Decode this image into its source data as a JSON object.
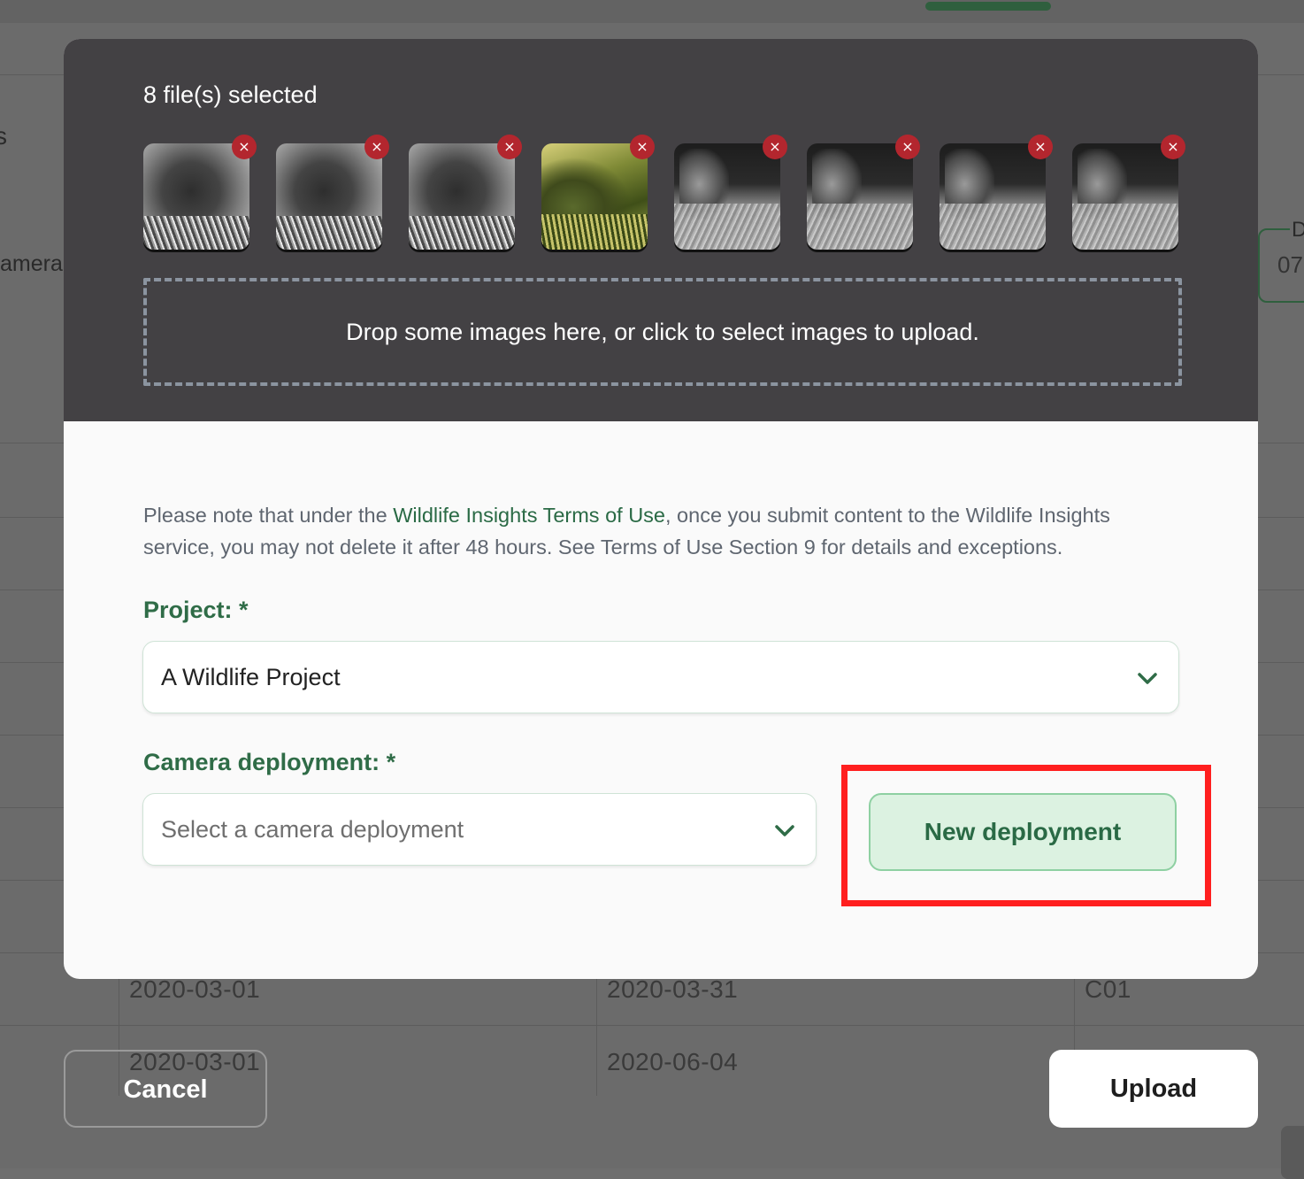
{
  "background": {
    "partial_heading": "s",
    "partial_column": "amera",
    "date_field_label": "D",
    "date_field_value": "07",
    "rows": [
      {
        "start": "2020-03-01",
        "end": "2020-03-31",
        "code": "C01"
      },
      {
        "start": "2020-03-01",
        "end": "2020-06-04",
        "code": ""
      }
    ]
  },
  "upload": {
    "files_selected_text": "8 file(s) selected",
    "thumbnails": [
      {
        "name": "elephant-photo-1",
        "style": "day-bw",
        "remove_icon": "close-icon"
      },
      {
        "name": "elephant-photo-2",
        "style": "day-bw",
        "remove_icon": "close-icon"
      },
      {
        "name": "elephant-photo-3",
        "style": "day-bw",
        "remove_icon": "close-icon"
      },
      {
        "name": "forest-color-photo",
        "style": "color-forest",
        "remove_icon": "close-icon"
      },
      {
        "name": "night-ir-photo-1",
        "style": "night",
        "remove_icon": "close-icon"
      },
      {
        "name": "night-ir-photo-2",
        "style": "night",
        "remove_icon": "close-icon"
      },
      {
        "name": "night-ir-photo-3",
        "style": "night",
        "remove_icon": "close-icon"
      },
      {
        "name": "night-ir-photo-4",
        "style": "night",
        "remove_icon": "close-icon"
      }
    ],
    "dropzone_text": "Drop some images here, or click to select images to upload."
  },
  "notice": {
    "prefix": "Please note that under the ",
    "link": "Wildlife Insights Terms of Use",
    "suffix": ", once you submit content to the Wildlife Insights service, you may not delete it after 48 hours. See Terms of Use Section 9 for details and exceptions."
  },
  "project": {
    "label": "Project: *",
    "value": "A Wildlife Project"
  },
  "deployment": {
    "label": "Camera deployment: *",
    "placeholder": "Select a camera deployment",
    "new_button": "New deployment"
  },
  "footer": {
    "cancel": "Cancel",
    "upload": "Upload"
  },
  "colors": {
    "brand_green": "#2f6c47",
    "remove_red": "#b3262e",
    "highlight_red": "#ff1f1f",
    "modal_dark": "#434144"
  }
}
